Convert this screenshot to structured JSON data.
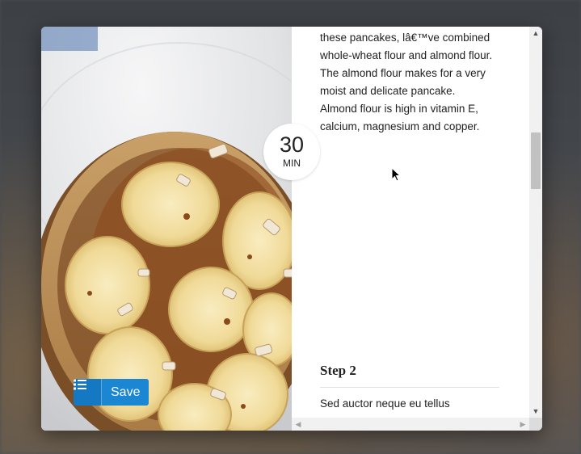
{
  "recipe": {
    "timer": {
      "value": "30",
      "unit": "MIN"
    },
    "save": {
      "list_icon": "list-icon",
      "label": "Save"
    },
    "intro_lines": [
      "these pancakes, lâ€™ve combined",
      "whole-wheat flour and almond flour.",
      "The almond flour makes for a very",
      "moist and delicate pancake.",
      "Almond flour is high in vitamin E,",
      "calcium, magnesium and copper."
    ],
    "step2": {
      "title": "Step 2",
      "text": "Sed auctor neque eu tellus"
    }
  },
  "scrollbars": {
    "vertical_position": 0.3,
    "up_icon": "chevron-up-icon",
    "down_icon": "chevron-down-icon",
    "left_icon": "chevron-left-icon",
    "right_icon": "chevron-right-icon"
  },
  "colors": {
    "save_button": "#1b86d2",
    "save_list_button": "#1479c2",
    "overlay": "#4a4d52"
  }
}
